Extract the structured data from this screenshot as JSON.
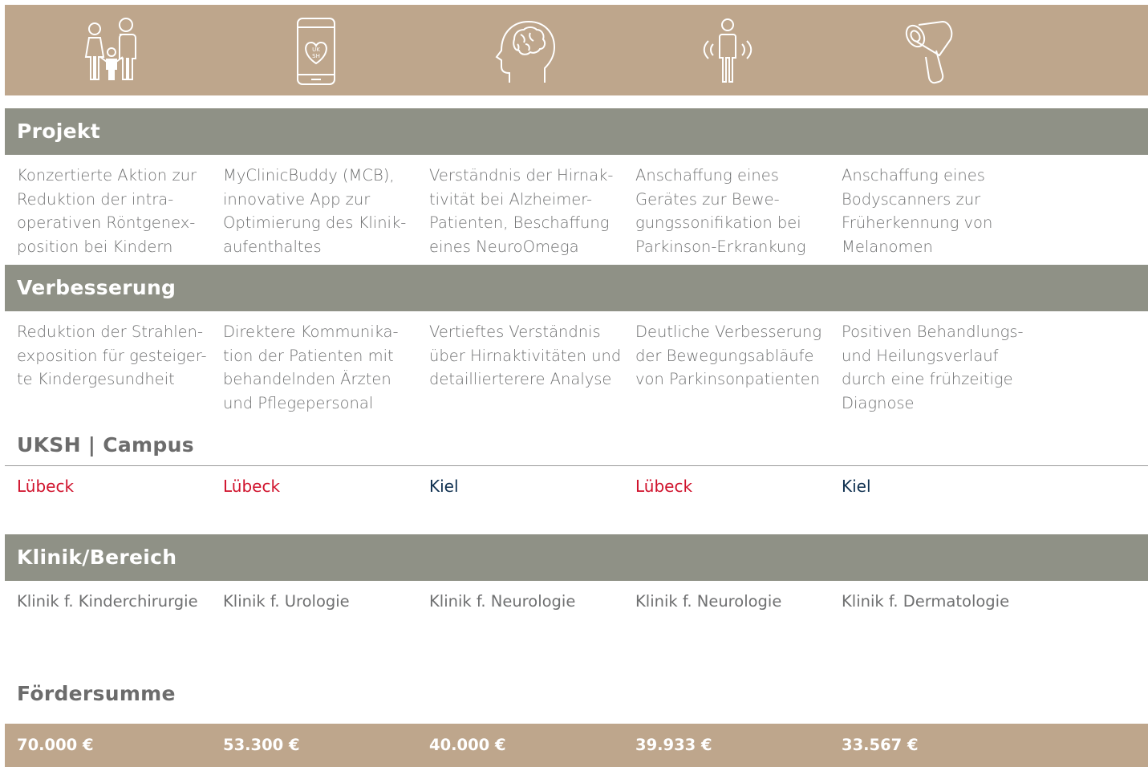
{
  "icons": [
    "family-icon",
    "smartphone-heart-icon",
    "brain-head-icon",
    "person-motion-icon",
    "bodyscanner-icon"
  ],
  "icon_phone_text": [
    "UK",
    "SH"
  ],
  "sections": {
    "projekt": "Projekt",
    "verbesserung": "Verbesserung",
    "campus": "UKSH | Campus",
    "klinik": "Klinik/Bereich",
    "foerdersumme": "Fördersumme"
  },
  "projekt": [
    "Konzertierte Aktion zur\nReduktion der intra-\noperativen Röntgenex-\nposition bei Kindern",
    "MyClinicBuddy (MCB),\ninnovative App zur\nOptimierung des Klinik-\naufenthaltes",
    "Verständnis der Hirnak-\ntivität bei Alzheimer-\nPatienten, Beschaffung\neines NeuroOmega",
    "Anschaffung eines\nGerätes zur Bewe-\ngungssonifikation bei\nParkinson-Erkrankung",
    "Anschaffung eines\nBodyscanners zur\nFrüherkennung von\nMelanomen"
  ],
  "verbesserung": [
    "Reduktion der Strahlen-\nexposition für gesteiger-\nte Kindergesundheit",
    "Direktere Kommunika-\ntion der Patienten mit\nbehandelnden Ärzten\nund Pflegepersonal",
    "Vertieftes Verständnis\nüber Hirnaktivitäten und\ndetaillierterere Analyse",
    "Deutliche Verbesserung\nder Bewegungsabläufe\nvon Parkinsonpatienten",
    "Positiven Behandlungs-\nund Heilungsverlauf\ndurch eine frühzeitige\nDiagnose"
  ],
  "campus": [
    {
      "name": "Lübeck",
      "color": "#d0112b"
    },
    {
      "name": "Lübeck",
      "color": "#d0112b"
    },
    {
      "name": "Kiel",
      "color": "#0f3050"
    },
    {
      "name": "Lübeck",
      "color": "#d0112b"
    },
    {
      "name": "Kiel",
      "color": "#0f3050"
    }
  ],
  "klinik": [
    "Klinik f. Kinderchirurgie",
    "Klinik f. Urologie",
    "Klinik f. Neurologie",
    "Klinik f. Neurologie",
    "Klinik f. Dermatologie"
  ],
  "foerdersumme": [
    "70.000 €",
    "53.300 €",
    "40.000 €",
    "39.933 €",
    "33.567 €"
  ],
  "colors": {
    "beige": "#bea68c",
    "grey": "#8f9186",
    "luebeck": "#d0112b",
    "kiel": "#0f3050"
  }
}
